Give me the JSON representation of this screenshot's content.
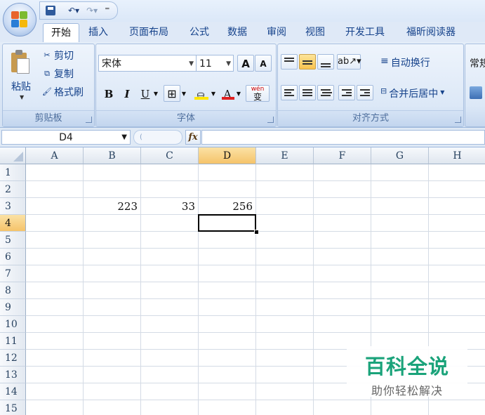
{
  "tabs": [
    "开始",
    "插入",
    "页面布局",
    "公式",
    "数据",
    "审阅",
    "视图",
    "开发工具",
    "福昕阅读器"
  ],
  "active_tab": "开始",
  "clipboard": {
    "paste": "粘贴",
    "cut": "剪切",
    "copy": "复制",
    "format_painter": "格式刷",
    "group_label": "剪贴板"
  },
  "font": {
    "name": "宋体",
    "size": "11",
    "grow": "A",
    "shrink": "A",
    "bold": "B",
    "italic": "I",
    "underline": "U",
    "font_color_letter": "A",
    "phonetic": "wén",
    "phonetic_char": "变",
    "group_label": "字体",
    "fill_color": "#ffe600",
    "font_color": "#e02020"
  },
  "alignment": {
    "wrap_text": "自动换行",
    "merge_center": "合并后居中",
    "group_label": "对齐方式"
  },
  "number": {
    "format": "常规"
  },
  "formula_bar": {
    "name_box": "D4",
    "fx": "fx",
    "formula": ""
  },
  "columns": [
    "A",
    "B",
    "C",
    "D",
    "E",
    "F",
    "G",
    "H"
  ],
  "rows": [
    "1",
    "2",
    "3",
    "4",
    "5",
    "6",
    "7",
    "8",
    "9",
    "10",
    "11",
    "12",
    "13",
    "14",
    "15"
  ],
  "active_cell": {
    "column": "D",
    "row": "4"
  },
  "cells": [
    {
      "ref": "B3",
      "value": "223"
    },
    {
      "ref": "C3",
      "value": "33"
    },
    {
      "ref": "D3",
      "value": "256"
    }
  ],
  "watermark": {
    "title": "百科全说",
    "subtitle": "助你轻松解决"
  }
}
